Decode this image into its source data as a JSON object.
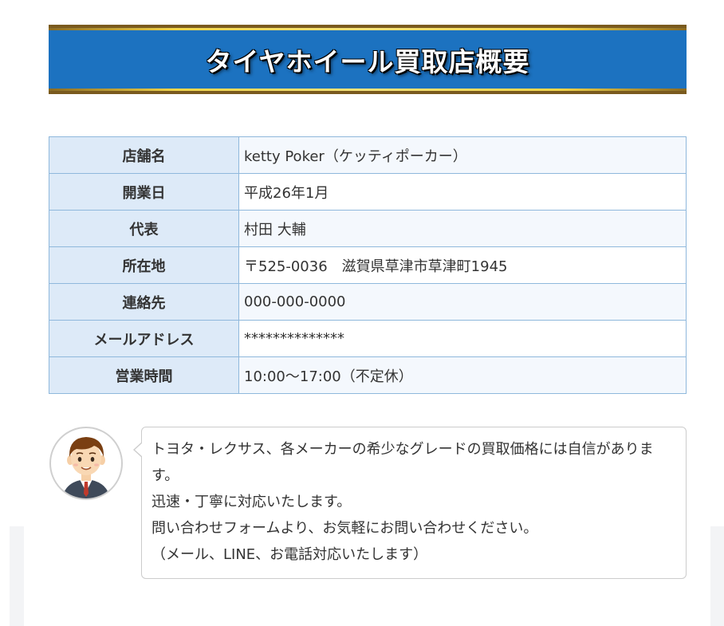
{
  "banner": {
    "title": "タイヤホイール買取店概要"
  },
  "shop_info": {
    "rows": [
      {
        "label": "店舗名",
        "value": "ketty Poker（ケッティポーカー）"
      },
      {
        "label": "開業日",
        "value": "平成26年1月"
      },
      {
        "label": "代表",
        "value": "村田 大輔"
      },
      {
        "label": "所在地",
        "value": "〒525-0036　滋賀県草津市草津町1945"
      },
      {
        "label": "連絡先",
        "value": "000-000-0000"
      },
      {
        "label": "メールアドレス",
        "value": "**************"
      },
      {
        "label": "営業時間",
        "value": "10:00〜17:00（不定休）"
      }
    ]
  },
  "message": {
    "lines": [
      "トヨタ・レクサス、各メーカーの希少なグレードの買取価格には自信があります。",
      "迅速・丁寧に対応いたします。",
      "問い合わせフォームより、お気軽にお問い合わせください。",
      "（メール、LINE、お電話対応いたします）"
    ]
  },
  "colors": {
    "banner_bg": "#1c72c0",
    "label_bg": "#ddeaf8",
    "table_border": "#8fb8dc"
  }
}
